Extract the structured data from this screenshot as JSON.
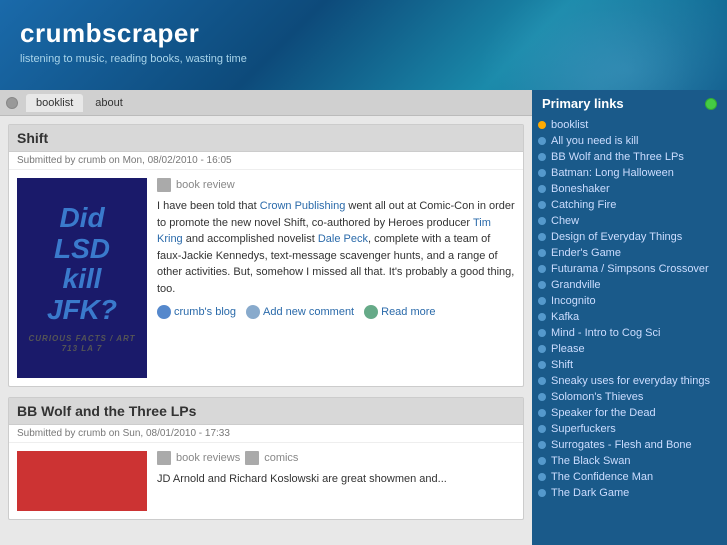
{
  "site": {
    "title": "crumbscraper",
    "tagline": "listening to music, reading books, wasting time"
  },
  "nav": {
    "tabs": [
      "booklist",
      "about"
    ],
    "active": "booklist"
  },
  "posts": [
    {
      "id": "post-shift",
      "title": "Shift",
      "meta": "Submitted by crumb on Mon, 08/02/2010 - 16:05",
      "tag_icon": "book-icon",
      "tag": "book review",
      "book_text": "Did\nLSD\nkill\nJFK?",
      "book_sub": "CURIOUS FACTS / ART 713 LA 7",
      "content": "I have been told that Crown Publishing went all out at Comic-Con in order to promote the new novel Shift, co-authored by Heroes producer Tim Kring and accomplished novelist Dale Peck, complete with a team of faux-Jackie Kennedys, text-message scavenger hunts, and a range of other activities. But, somehow I missed all that. It's probably a good thing, too.",
      "content_links": [
        "Crown Publishing",
        "Tim Kring",
        "Dale Peck"
      ],
      "actions": [
        {
          "label": "crumb's blog",
          "type": "user"
        },
        {
          "label": "Add new comment",
          "type": "comment"
        },
        {
          "label": "Read more",
          "type": "read"
        }
      ]
    },
    {
      "id": "post-bb-wolf",
      "title": "BB Wolf and the Three LPs",
      "meta": "Submitted by crumb on Sun, 08/01/2010 - 17:33",
      "tags": [
        "book reviews",
        "comics"
      ],
      "content_preview": "JD Arnold and Richard Koslowski are great showmen and..."
    }
  ],
  "sidebar": {
    "header": "Primary links",
    "sections": [
      {
        "label": "booklist",
        "bullet": "orange",
        "items": [
          {
            "label": "All you need is kill",
            "bullet": "blue"
          },
          {
            "label": "BB Wolf and the Three LPs",
            "bullet": "blue"
          },
          {
            "label": "Batman: Long Halloween",
            "bullet": "blue"
          },
          {
            "label": "Boneshaker",
            "bullet": "blue"
          },
          {
            "label": "Catching Fire",
            "bullet": "blue"
          },
          {
            "label": "Chew",
            "bullet": "blue"
          },
          {
            "label": "Design of Everyday Things",
            "bullet": "blue"
          },
          {
            "label": "Ender's Game",
            "bullet": "blue"
          },
          {
            "label": "Futurama / Simpsons Crossover",
            "bullet": "blue"
          },
          {
            "label": "Grandville",
            "bullet": "blue"
          },
          {
            "label": "Incognito",
            "bullet": "blue"
          },
          {
            "label": "Kafka",
            "bullet": "blue"
          },
          {
            "label": "Mind - Intro to Cog Sci",
            "bullet": "blue"
          },
          {
            "label": "Please",
            "bullet": "blue"
          },
          {
            "label": "Shift",
            "bullet": "blue"
          },
          {
            "label": "Sneaky uses for everyday things",
            "bullet": "blue"
          },
          {
            "label": "Solomon's Thieves",
            "bullet": "blue"
          },
          {
            "label": "Speaker for the Dead",
            "bullet": "blue"
          },
          {
            "label": "Superfuckers",
            "bullet": "blue"
          },
          {
            "label": "Surrogates - Flesh and Bone",
            "bullet": "blue"
          },
          {
            "label": "The Black Swan",
            "bullet": "blue"
          },
          {
            "label": "The Confidence Man",
            "bullet": "blue"
          },
          {
            "label": "The Dark Game",
            "bullet": "blue"
          }
        ]
      }
    ]
  }
}
